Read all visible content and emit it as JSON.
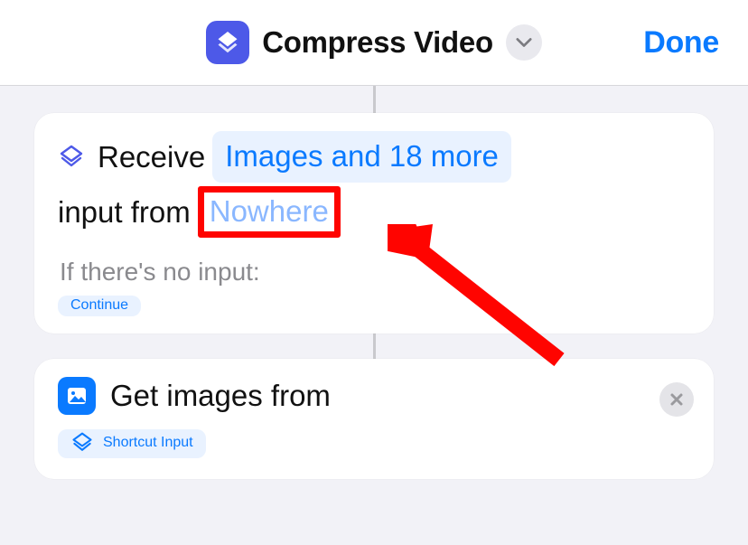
{
  "header": {
    "title": "Compress Video",
    "done": "Done"
  },
  "receive_card": {
    "verb": "Receive",
    "types_token": "Images and 18 more",
    "from_label": "input from",
    "source_token": "Nowhere",
    "no_input_label": "If there's no input:",
    "no_input_action": "Continue"
  },
  "get_card": {
    "label": "Get images from",
    "input_token": "Shortcut Input"
  },
  "annotation": {
    "target": "source_token"
  }
}
